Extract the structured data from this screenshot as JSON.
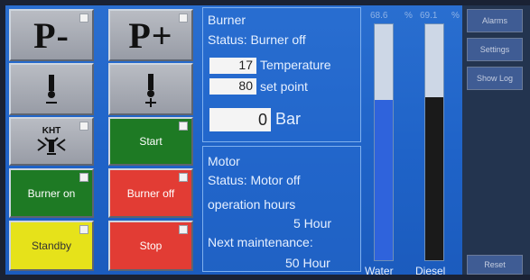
{
  "controls": {
    "p_minus": "P-",
    "p_plus": "P+",
    "kht_label": "KHT",
    "start": "Start",
    "burner_on": "Burner on",
    "burner_off": "Burner off",
    "standby": "Standby",
    "stop": "Stop"
  },
  "burner": {
    "title": "Burner",
    "status": "Status: Burner off",
    "temperature_value": "17",
    "temperature_label": "Temperature",
    "setpoint_value": "80",
    "setpoint_label": "set point",
    "pressure_value": "0",
    "pressure_unit": "Bar"
  },
  "motor": {
    "title": "Motor",
    "status": "Status: Motor off",
    "operation_hours_label": "operation hours",
    "operation_hours_value": "5 Hour",
    "next_maintenance_label": "Next maintenance:",
    "next_maintenance_value": "50 Hour"
  },
  "tanks": {
    "water_label": "Water",
    "water_scale": "68.6",
    "water_level": 0.68,
    "water_color": "#2f63dc",
    "percent_symbol": "%",
    "diesel_label": "Diesel",
    "diesel_scale": "69.1",
    "diesel_level": 0.69,
    "diesel_color": "#1a1a1a"
  },
  "side": {
    "alarms": "Alarms",
    "settings": "Settings",
    "show_log": "Show Log",
    "reset": "Reset"
  }
}
